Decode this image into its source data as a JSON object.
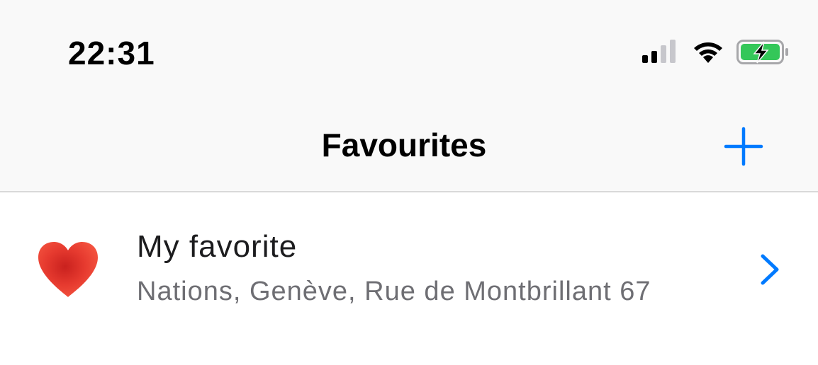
{
  "status_bar": {
    "time": "22:31",
    "icons": [
      "cellular-signal-icon",
      "wifi-icon",
      "battery-charging-icon"
    ],
    "battery_color": "#34c759"
  },
  "nav": {
    "title": "Favourites",
    "add_icon": "plus-icon",
    "accent_color": "#007aff"
  },
  "favorites": [
    {
      "icon": "heart-icon",
      "title": "My favorite",
      "subtitle": "Nations, Genève, Rue de Montbrillant 67"
    }
  ]
}
